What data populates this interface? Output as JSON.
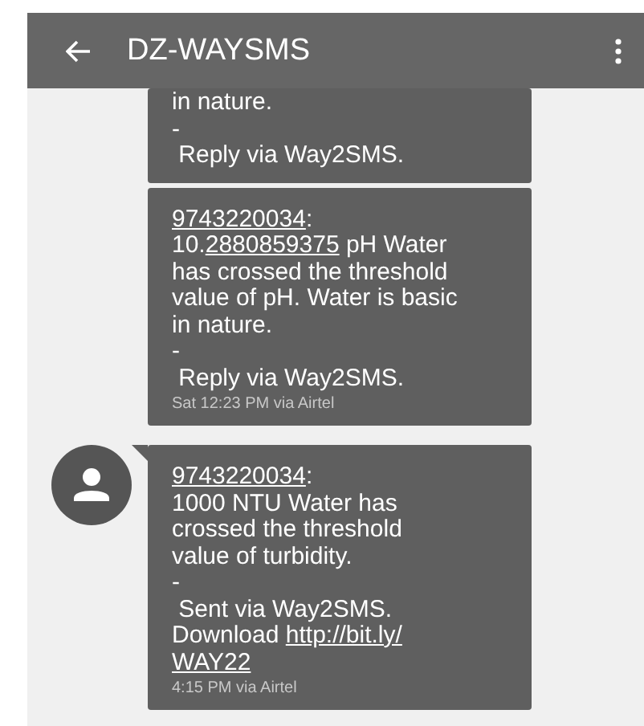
{
  "app_bar": {
    "title": "DZ-WAYSMS"
  },
  "messages": [
    {
      "avatar": false,
      "lines": [
        [
          {
            "text": "in nature.",
            "link": false
          }
        ],
        [
          {
            "text": "-",
            "link": false
          }
        ],
        [
          {
            "text": " Reply via Way2SMS.",
            "link": false
          }
        ]
      ]
    },
    {
      "avatar": false,
      "lines": [
        [
          {
            "text": "9743220034",
            "link": true
          },
          {
            "text": ":",
            "link": false
          }
        ],
        [
          {
            "text": "10.",
            "link": false
          },
          {
            "text": "2880859375",
            "link": true
          },
          {
            "text": " pH Water",
            "link": false
          }
        ],
        [
          {
            "text": "has crossed the threshold",
            "link": false
          }
        ],
        [
          {
            "text": "value of pH. Water is basic",
            "link": false
          }
        ],
        [
          {
            "text": "in nature.",
            "link": false
          }
        ],
        [
          {
            "text": "-",
            "link": false
          }
        ],
        [
          {
            "text": " Reply via Way2SMS.",
            "link": false
          }
        ]
      ],
      "meta": "Sat 12:23 PM via Airtel"
    },
    {
      "avatar": true,
      "lines": [
        [
          {
            "text": "9743220034",
            "link": true
          },
          {
            "text": ":",
            "link": false
          }
        ],
        [
          {
            "text": "1000 NTU Water has",
            "link": false
          }
        ],
        [
          {
            "text": "crossed the threshold",
            "link": false
          }
        ],
        [
          {
            "text": "value of turbidity.",
            "link": false
          }
        ],
        [
          {
            "text": "-",
            "link": false
          }
        ],
        [
          {
            "text": " Sent via Way2SMS.",
            "link": false
          }
        ],
        [
          {
            "text": "Download ",
            "link": false
          },
          {
            "text": "http://bit.ly/",
            "link": true
          }
        ],
        [
          {
            "text": "WAY22",
            "link": true
          }
        ]
      ],
      "meta": "4:15 PM via Airtel"
    }
  ]
}
